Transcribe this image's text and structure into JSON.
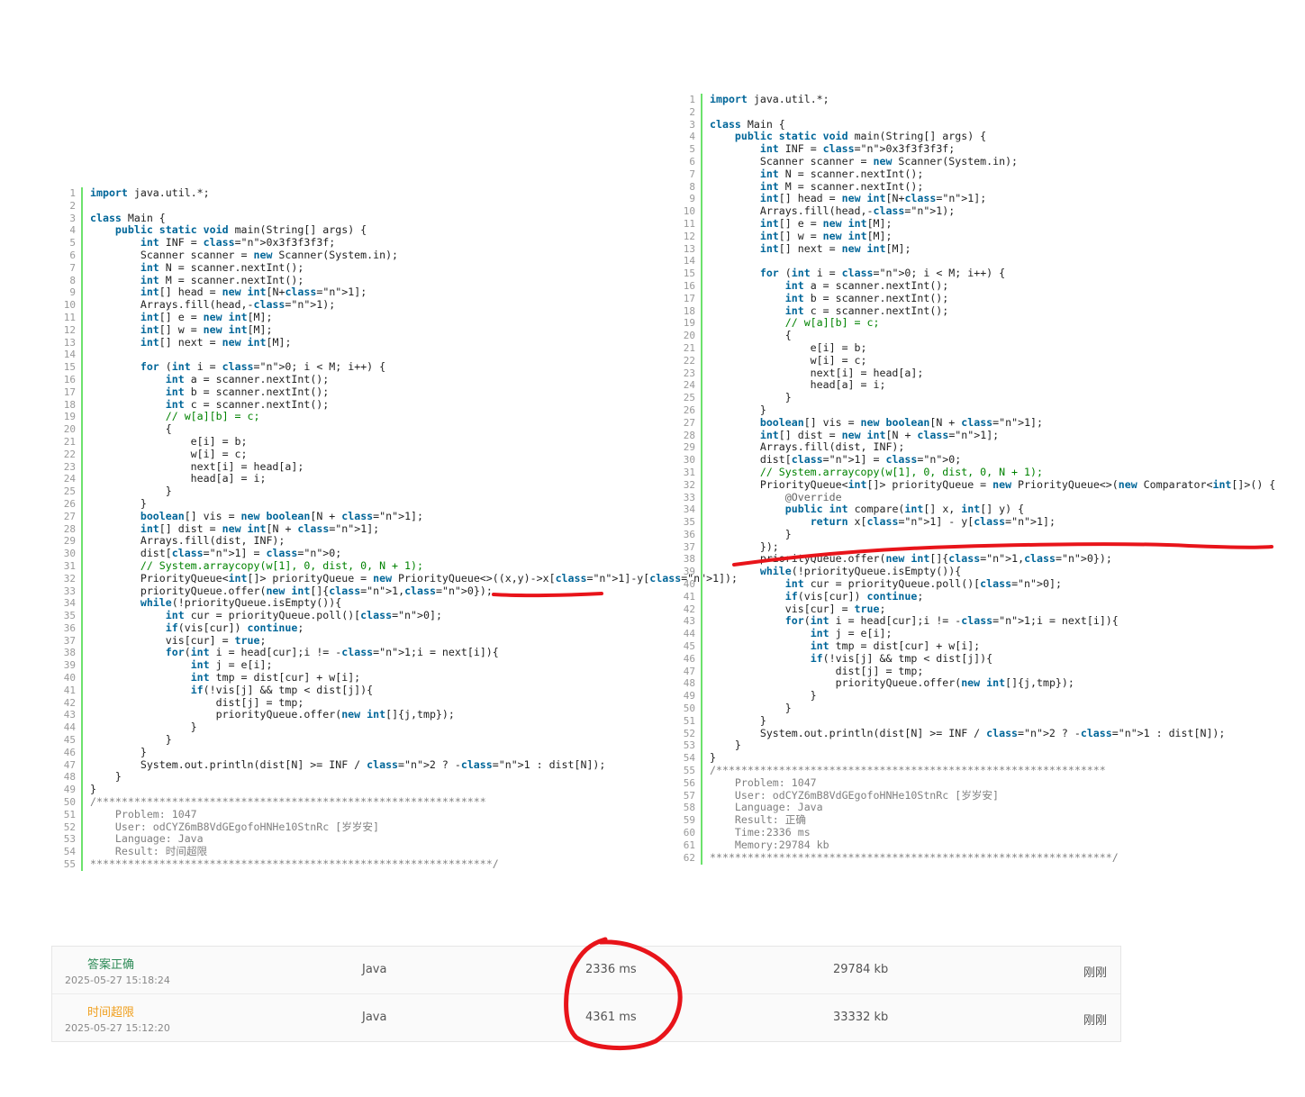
{
  "left_code": {
    "lines": [
      "import java.util.*;",
      "",
      "class Main {",
      "    public static void main(String[] args) {",
      "        int INF = 0x3f3f3f3f;",
      "        Scanner scanner = new Scanner(System.in);",
      "        int N = scanner.nextInt();",
      "        int M = scanner.nextInt();",
      "        int[] head = new int[N+1];",
      "        Arrays.fill(head,-1);",
      "        int[] e = new int[M];",
      "        int[] w = new int[M];",
      "        int[] next = new int[M];",
      "",
      "        for (int i = 0; i < M; i++) {",
      "            int a = scanner.nextInt();",
      "            int b = scanner.nextInt();",
      "            int c = scanner.nextInt();",
      "            // w[a][b] = c;",
      "            {",
      "                e[i] = b;",
      "                w[i] = c;",
      "                next[i] = head[a];",
      "                head[a] = i;",
      "            }",
      "        }",
      "        boolean[] vis = new boolean[N + 1];",
      "        int[] dist = new int[N + 1];",
      "        Arrays.fill(dist, INF);",
      "        dist[1] = 0;",
      "        // System.arraycopy(w[1], 0, dist, 0, N + 1);",
      "        PriorityQueue<int[]> priorityQueue = new PriorityQueue<>((x,y)->x[1]-y[1]);",
      "        priorityQueue.offer(new int[]{1,0});",
      "        while(!priorityQueue.isEmpty()){",
      "            int cur = priorityQueue.poll()[0];",
      "            if(vis[cur]) continue;",
      "            vis[cur] = true;",
      "            for(int i = head[cur];i != -1;i = next[i]){",
      "                int j = e[i];",
      "                int tmp = dist[cur] + w[i];",
      "                if(!vis[j] && tmp < dist[j]){",
      "                    dist[j] = tmp;",
      "                    priorityQueue.offer(new int[]{j,tmp});",
      "                }",
      "            }",
      "        }",
      "        System.out.println(dist[N] >= INF / 2 ? -1 : dist[N]);",
      "    }",
      "}",
      "/**************************************************************",
      "    Problem: 1047",
      "    User: odCYZ6mB8VdGEgofoHNHe10StnRc [岁岁安]",
      "    Language: Java",
      "    Result: 时间超限",
      "****************************************************************/"
    ]
  },
  "right_code": {
    "lines": [
      "import java.util.*;",
      "",
      "class Main {",
      "    public static void main(String[] args) {",
      "        int INF = 0x3f3f3f3f;",
      "        Scanner scanner = new Scanner(System.in);",
      "        int N = scanner.nextInt();",
      "        int M = scanner.nextInt();",
      "        int[] head = new int[N+1];",
      "        Arrays.fill(head,-1);",
      "        int[] e = new int[M];",
      "        int[] w = new int[M];",
      "        int[] next = new int[M];",
      "",
      "        for (int i = 0; i < M; i++) {",
      "            int a = scanner.nextInt();",
      "            int b = scanner.nextInt();",
      "            int c = scanner.nextInt();",
      "            // w[a][b] = c;",
      "            {",
      "                e[i] = b;",
      "                w[i] = c;",
      "                next[i] = head[a];",
      "                head[a] = i;",
      "            }",
      "        }",
      "        boolean[] vis = new boolean[N + 1];",
      "        int[] dist = new int[N + 1];",
      "        Arrays.fill(dist, INF);",
      "        dist[1] = 0;",
      "        // System.arraycopy(w[1], 0, dist, 0, N + 1);",
      "        PriorityQueue<int[]> priorityQueue = new PriorityQueue<>(new Comparator<int[]>() {",
      "            @Override",
      "            public int compare(int[] x, int[] y) {",
      "                return x[1] - y[1];",
      "            }",
      "        });",
      "        priorityQueue.offer(new int[]{1,0});",
      "        while(!priorityQueue.isEmpty()){",
      "            int cur = priorityQueue.poll()[0];",
      "            if(vis[cur]) continue;",
      "            vis[cur] = true;",
      "            for(int i = head[cur];i != -1;i = next[i]){",
      "                int j = e[i];",
      "                int tmp = dist[cur] + w[i];",
      "                if(!vis[j] && tmp < dist[j]){",
      "                    dist[j] = tmp;",
      "                    priorityQueue.offer(new int[]{j,tmp});",
      "                }",
      "            }",
      "        }",
      "        System.out.println(dist[N] >= INF / 2 ? -1 : dist[N]);",
      "    }",
      "}",
      "/**************************************************************",
      "    Problem: 1047",
      "    User: odCYZ6mB8VdGEgofoHNHe10StnRc [岁岁安]",
      "    Language: Java",
      "    Result: 正确",
      "    Time:2336 ms",
      "    Memory:29784 kb",
      "****************************************************************/"
    ]
  },
  "submissions": [
    {
      "status": "答案正确",
      "status_color": "#2e8b57",
      "submitted_at": "2025-05-27 15:18:24",
      "language": "Java",
      "time": "2336 ms",
      "memory": "29784 kb",
      "when": "刚刚"
    },
    {
      "status": "时间超限",
      "status_color": "#f0a020",
      "submitted_at": "2025-05-27 15:12:20",
      "language": "Java",
      "time": "4361 ms",
      "memory": "33332 kb",
      "when": "刚刚"
    }
  ],
  "colors": {
    "annotation": "#e8141a",
    "gutter": "#6ce26c"
  }
}
